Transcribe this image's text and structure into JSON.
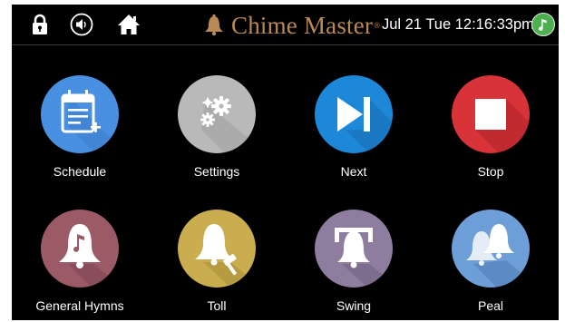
{
  "topbar": {
    "lock_icon": "lock-icon",
    "volume_icon": "volume-icon",
    "home_icon": "home-icon",
    "brand_name": "Chime Master",
    "brand_mark": "®",
    "datetime": "Jul 21 Tue 12:16:33pm",
    "status_icon": "music-note-icon",
    "status_color": "#4cb04e"
  },
  "tiles": [
    {
      "label": "Schedule",
      "icon": "calendar-add-icon",
      "color": "#4a90e2"
    },
    {
      "label": "Settings",
      "icon": "gears-icon",
      "color": "#b9b9b9"
    },
    {
      "label": "Next",
      "icon": "skip-next-icon",
      "color": "#1e88d8"
    },
    {
      "label": "Stop",
      "icon": "stop-icon",
      "color": "#d9333a"
    },
    {
      "label": "General Hymns",
      "icon": "bell-music-icon",
      "color": "#9b5a66"
    },
    {
      "label": "Toll",
      "icon": "bell-hammer-icon",
      "color": "#c9ad4f"
    },
    {
      "label": "Swing",
      "icon": "swinging-bell-icon",
      "color": "#8f7da0"
    },
    {
      "label": "Peal",
      "icon": "double-bell-icon",
      "color": "#6d9ed8"
    }
  ]
}
